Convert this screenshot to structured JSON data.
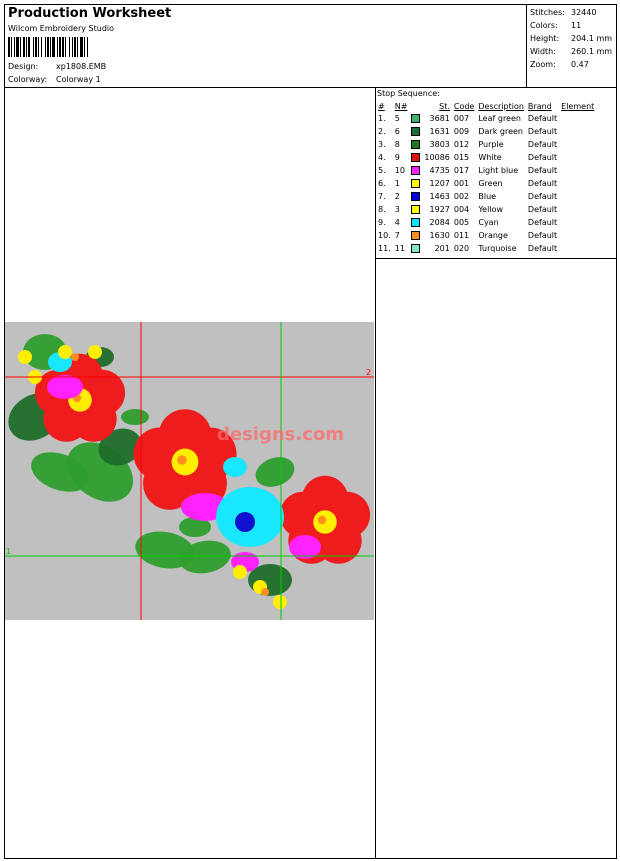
{
  "header": {
    "title": "Production Worksheet",
    "software": "Wilcom Embroidery Studio",
    "design_label": "Design:",
    "design_value": "xp1808.EMB",
    "colorway_label": "Colorway:",
    "colorway_value": "Colorway 1"
  },
  "stats": {
    "stitches_label": "Stitches:",
    "stitches_value": "32440",
    "colors_label": "Colors:",
    "colors_value": "11",
    "height_label": "Height:",
    "height_value": "204.1 mm",
    "width_label": "Width:",
    "width_value": "260.1 mm",
    "zoom_label": "Zoom:",
    "zoom_value": "0.47"
  },
  "stop_sequence": {
    "title": "Stop Sequence:",
    "headers": [
      "#",
      "N#",
      "St.",
      "Code",
      "Description",
      "Brand",
      "Element"
    ],
    "rows": [
      {
        "idx": "1.",
        "n": "5",
        "st": "3681",
        "code": "007",
        "desc": "Leaf green",
        "brand": "Default",
        "color": "#3cb371"
      },
      {
        "idx": "2.",
        "n": "6",
        "st": "1631",
        "code": "009",
        "desc": "Dark green",
        "brand": "Default",
        "color": "#1e6b3a"
      },
      {
        "idx": "3.",
        "n": "8",
        "st": "3803",
        "code": "012",
        "desc": "Purple",
        "brand": "Default",
        "color": "#1f7a1f"
      },
      {
        "idx": "4.",
        "n": "9",
        "st": "10086",
        "code": "015",
        "desc": "White",
        "brand": "Default",
        "color": "#e01010"
      },
      {
        "idx": "5.",
        "n": "10",
        "st": "4735",
        "code": "017",
        "desc": "Light blue",
        "brand": "Default",
        "color": "#ff20ff"
      },
      {
        "idx": "6.",
        "n": "1",
        "st": "1207",
        "code": "001",
        "desc": "Green",
        "brand": "Default",
        "color": "#ffff00"
      },
      {
        "idx": "7.",
        "n": "2",
        "st": "1463",
        "code": "002",
        "desc": "Blue",
        "brand": "Default",
        "color": "#0000e0"
      },
      {
        "idx": "8.",
        "n": "3",
        "st": "1927",
        "code": "004",
        "desc": "Yellow",
        "brand": "Default",
        "color": "#ffff00"
      },
      {
        "idx": "9.",
        "n": "4",
        "st": "2084",
        "code": "005",
        "desc": "Cyan",
        "brand": "Default",
        "color": "#00e5ff"
      },
      {
        "idx": "10.",
        "n": "7",
        "st": "1630",
        "code": "011",
        "desc": "Orange",
        "brand": "Default",
        "color": "#ff8c1a"
      },
      {
        "idx": "11.",
        "n": "11",
        "st": "201",
        "code": "020",
        "desc": "Turquoise",
        "brand": "Default",
        "color": "#7fe8c8"
      }
    ]
  },
  "preview": {
    "watermark": "designs.com",
    "marker_right": "2",
    "marker_left": "1",
    "colors": {
      "background": "#c0c0c0",
      "leaf": "#2e9e2e",
      "dark_leaf": "#1f6e2a",
      "petal_red": "#ee1c1c",
      "petal_magenta": "#ff22ff",
      "cyan": "#19e6ff",
      "yellow": "#ffee00",
      "orange": "#ff9020",
      "blue": "#1010d0",
      "guide_red": "#ff0000",
      "guide_green": "#00cc00"
    }
  }
}
